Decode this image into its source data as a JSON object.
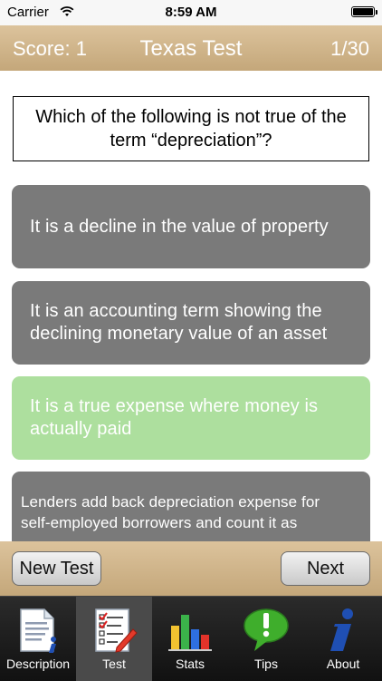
{
  "status_bar": {
    "carrier": "Carrier",
    "time": "8:59 AM"
  },
  "header": {
    "score": "Score: 1",
    "title": "Texas Test",
    "progress": "1/30"
  },
  "question": {
    "text": "Which of the following is not true of the term “depreciation”?"
  },
  "answers": [
    {
      "text": "It is a decline in the value of property",
      "state": "default"
    },
    {
      "text": "It is an accounting term showing the declining monetary value of an asset",
      "state": "default"
    },
    {
      "text": "It is a true expense where money is actually paid",
      "state": "correct"
    },
    {
      "text": "Lenders add back depreciation expense for self-employed borrowers and count it as",
      "state": "default"
    }
  ],
  "buttons": {
    "new_test": "New Test",
    "next": "Next"
  },
  "tabs": [
    {
      "label": "Description",
      "icon": "document-icon",
      "active": false
    },
    {
      "label": "Test",
      "icon": "checklist-icon",
      "active": true
    },
    {
      "label": "Stats",
      "icon": "bar-chart-icon",
      "active": false
    },
    {
      "label": "Tips",
      "icon": "speech-bubble-exclamation-icon",
      "active": false
    },
    {
      "label": "About",
      "icon": "info-icon",
      "active": false
    }
  ],
  "colors": {
    "header": "#c9ae84",
    "answer_default": "#7a7a7a",
    "answer_correct": "#addf9e",
    "tab_bar": "#1a1a1a"
  }
}
